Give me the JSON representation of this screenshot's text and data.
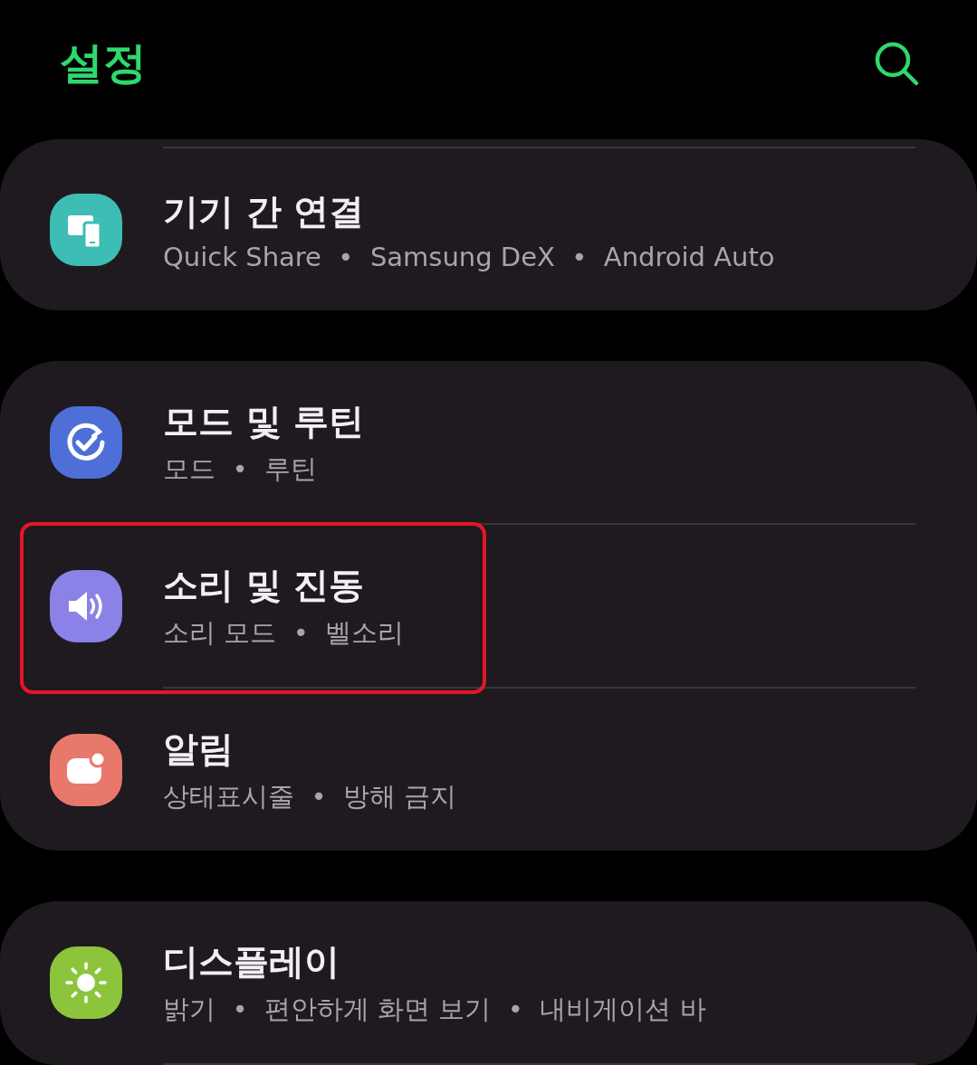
{
  "header": {
    "title": "설정"
  },
  "groups": [
    {
      "continued_above": true,
      "continued_below": false,
      "items": [
        {
          "title": "기기 간 연결",
          "subtitle": "Quick Share  •  Samsung DeX  •  Android Auto",
          "color": "#3dbdb3",
          "highlighted": false
        }
      ]
    },
    {
      "continued_above": false,
      "continued_below": false,
      "items": [
        {
          "title": "모드 및 루틴",
          "subtitle": "모드  •  루틴",
          "color": "#4f6fd8",
          "highlighted": false
        },
        {
          "title": "소리 및 진동",
          "subtitle": "소리 모드  •  벨소리",
          "color": "#8a82e6",
          "highlighted": true
        },
        {
          "title": "알림",
          "subtitle": "상태표시줄  •  방해 금지",
          "color": "#e8786b",
          "highlighted": false
        }
      ]
    },
    {
      "continued_above": false,
      "continued_below": true,
      "items": [
        {
          "title": "디스플레이",
          "subtitle": "밝기  •  편안하게 화면 보기  •  내비게이션 바",
          "color": "#8cc53c",
          "highlighted": false
        }
      ]
    }
  ]
}
